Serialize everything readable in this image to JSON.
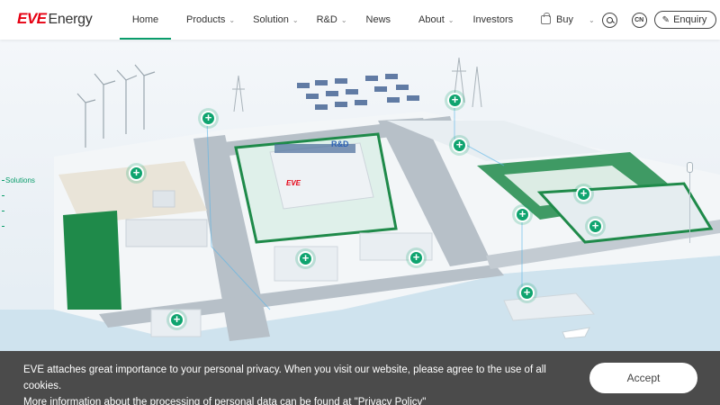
{
  "header": {
    "logo_brand": "EVE",
    "logo_suffix": "Energy",
    "nav": [
      {
        "label": "Home",
        "dropdown": false,
        "active": true
      },
      {
        "label": "Products",
        "dropdown": true,
        "active": false
      },
      {
        "label": "Solution",
        "dropdown": true,
        "active": false
      },
      {
        "label": "R&D",
        "dropdown": true,
        "active": false
      },
      {
        "label": "News",
        "dropdown": false,
        "active": false
      },
      {
        "label": "About",
        "dropdown": true,
        "active": false
      },
      {
        "label": "Investors",
        "dropdown": false,
        "active": false
      }
    ],
    "buy_label": "Buy",
    "language_label": "CN",
    "enquiry_label": "Enquiry",
    "icons": {
      "buy": "shopping-bag-icon",
      "search": "search-icon",
      "enquiry": "pen-icon"
    }
  },
  "scene": {
    "side_nav": [
      "Solutions",
      "",
      "",
      ""
    ],
    "building_label": "R&D",
    "building_logo": "EVE",
    "accent_color": "#0a9d6b"
  },
  "cookie": {
    "line1": "EVE attaches great importance to your personal privacy. When you visit our website, please agree to the use of all cookies.",
    "line2_prefix": "More information about the processing of personal data can be found at ",
    "policy_link": "\"Privacy Policy\"",
    "accept_label": "Accept"
  }
}
